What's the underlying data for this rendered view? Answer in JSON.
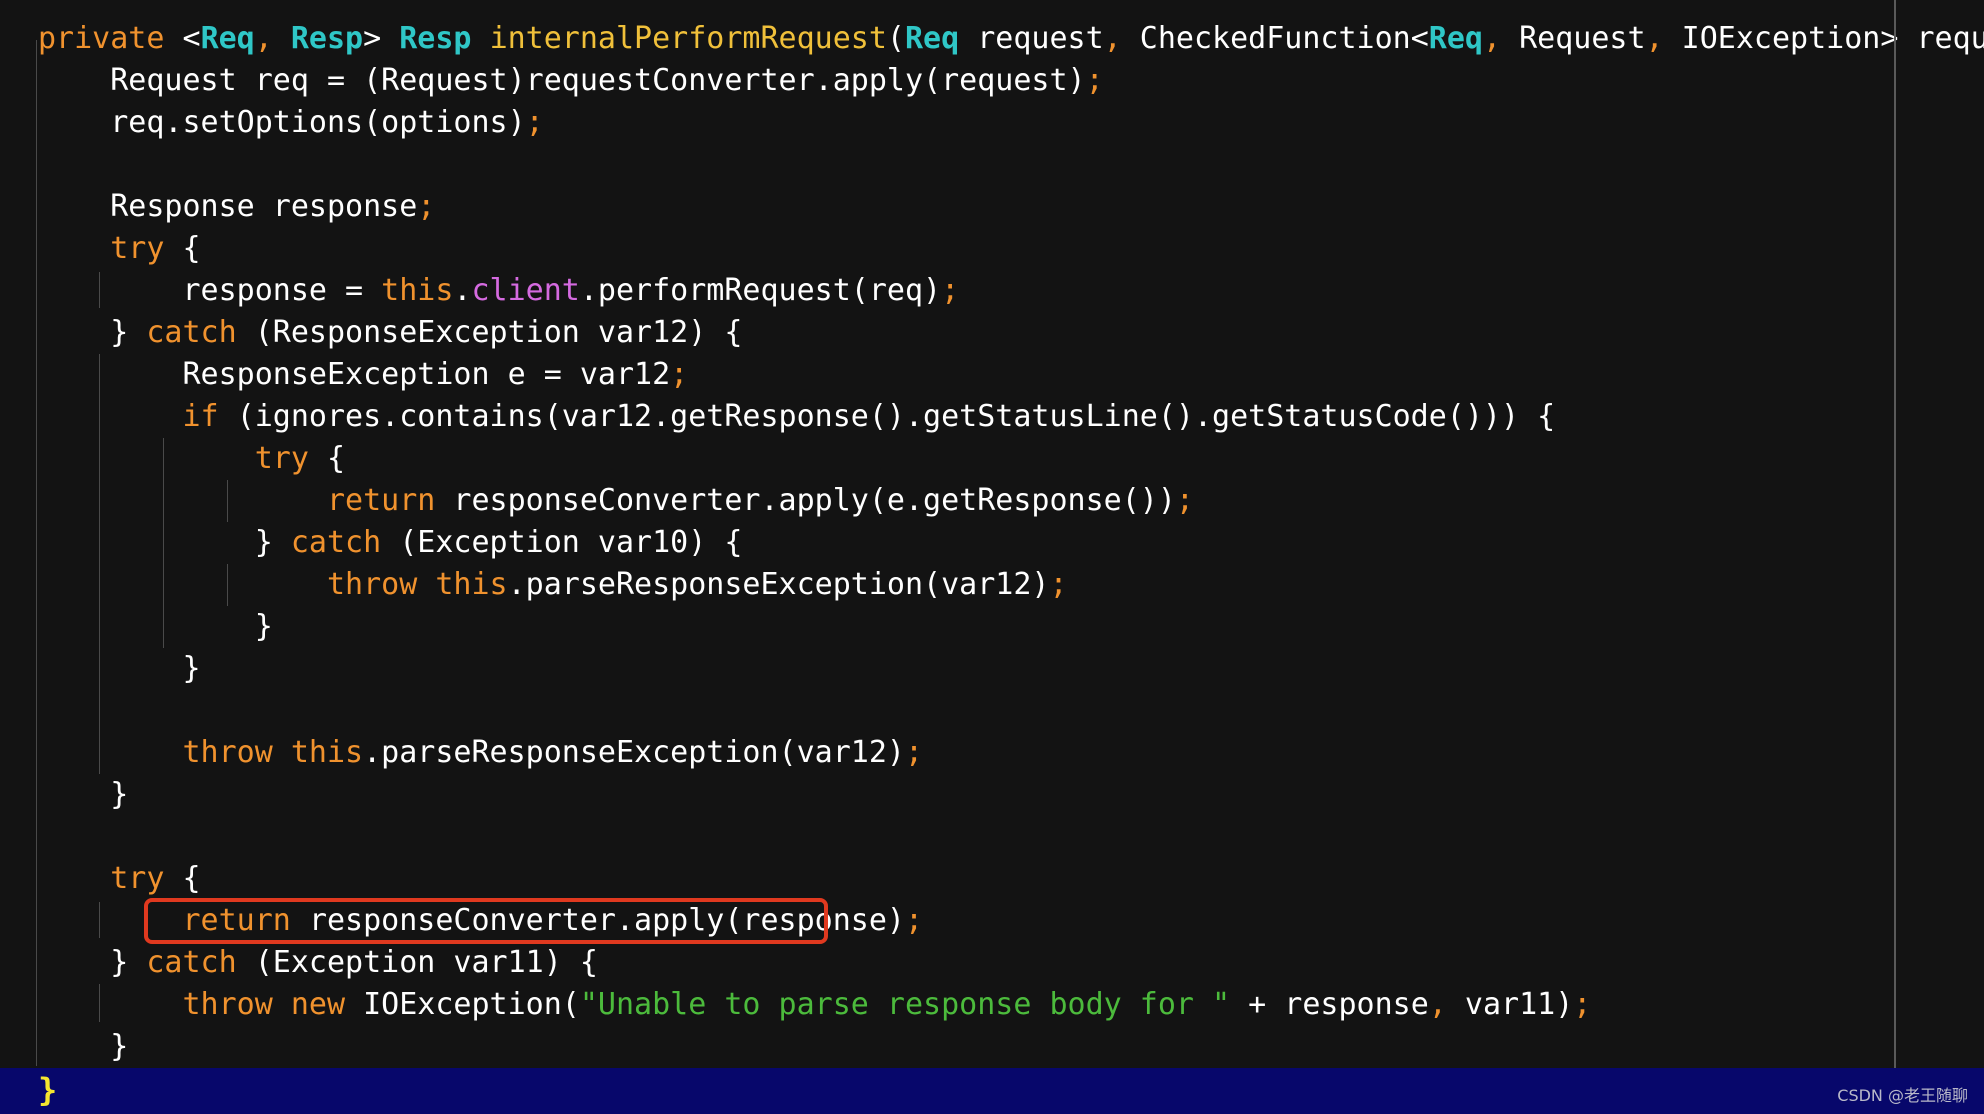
{
  "editor": {
    "lines": [
      [
        [
          "kw",
          "private "
        ],
        [
          "plain",
          "<"
        ],
        [
          "type",
          "Req"
        ],
        [
          "punct",
          ", "
        ],
        [
          "type",
          "Resp"
        ],
        [
          "plain",
          "> "
        ],
        [
          "type",
          "Resp"
        ],
        [
          "plain",
          " "
        ],
        [
          "fn",
          "internalPerformRequest"
        ],
        [
          "plain",
          "("
        ],
        [
          "type",
          "Req"
        ],
        [
          "plain",
          " request"
        ],
        [
          "punct",
          ", "
        ],
        [
          "plain",
          "CheckedFunction<"
        ],
        [
          "type",
          "Req"
        ],
        [
          "punct",
          ", "
        ],
        [
          "plain",
          "Request"
        ],
        [
          "punct",
          ", "
        ],
        [
          "plain",
          "IOException> requestConverter"
        ],
        [
          "punct",
          ","
        ]
      ],
      [
        [
          "plain",
          "    Request req = (Request)requestConverter.apply(request)"
        ],
        [
          "punct",
          ";"
        ]
      ],
      [
        [
          "plain",
          "    req.setOptions(options)"
        ],
        [
          "punct",
          ";"
        ]
      ],
      [],
      [
        [
          "plain",
          "    Response response"
        ],
        [
          "punct",
          ";"
        ]
      ],
      [
        [
          "kw",
          "    try "
        ],
        [
          "plain",
          "{"
        ]
      ],
      [
        [
          "plain",
          "        response = "
        ],
        [
          "kw",
          "this"
        ],
        [
          "plain",
          "."
        ],
        [
          "field",
          "client"
        ],
        [
          "plain",
          ".performRequest(req)"
        ],
        [
          "punct",
          ";"
        ]
      ],
      [
        [
          "plain",
          "    } "
        ],
        [
          "kw",
          "catch "
        ],
        [
          "plain",
          "(ResponseException var12) {"
        ]
      ],
      [
        [
          "plain",
          "        ResponseException e = var12"
        ],
        [
          "punct",
          ";"
        ]
      ],
      [
        [
          "kw",
          "        if "
        ],
        [
          "plain",
          "(ignores.contains(var12.getResponse().getStatusLine().getStatusCode())) {"
        ]
      ],
      [
        [
          "kw",
          "            try "
        ],
        [
          "plain",
          "{"
        ]
      ],
      [
        [
          "kw",
          "                return "
        ],
        [
          "plain",
          "responseConverter.apply(e.getResponse())"
        ],
        [
          "punct",
          ";"
        ]
      ],
      [
        [
          "plain",
          "            } "
        ],
        [
          "kw",
          "catch "
        ],
        [
          "plain",
          "(Exception var10) {"
        ]
      ],
      [
        [
          "kw",
          "                throw this"
        ],
        [
          "plain",
          ".parseResponseException(var12)"
        ],
        [
          "punct",
          ";"
        ]
      ],
      [
        [
          "plain",
          "            }"
        ]
      ],
      [
        [
          "plain",
          "        }"
        ]
      ],
      [],
      [
        [
          "kw",
          "        throw this"
        ],
        [
          "plain",
          ".parseResponseException(var12)"
        ],
        [
          "punct",
          ";"
        ]
      ],
      [
        [
          "plain",
          "    }"
        ]
      ],
      [],
      [
        [
          "kw",
          "    try "
        ],
        [
          "plain",
          "{"
        ]
      ],
      [
        [
          "kw",
          "        return "
        ],
        [
          "plain",
          "responseConverter.apply(response)"
        ],
        [
          "punct",
          ";"
        ]
      ],
      [
        [
          "plain",
          "    } "
        ],
        [
          "kw",
          "catch "
        ],
        [
          "plain",
          "(Exception var11) {"
        ]
      ],
      [
        [
          "kw",
          "        throw new "
        ],
        [
          "plain",
          "IOException("
        ],
        [
          "str",
          "\"Unable to parse response body for \""
        ],
        [
          "plain",
          " + response"
        ],
        [
          "punct",
          ", "
        ],
        [
          "plain",
          "var11)"
        ],
        [
          "punct",
          ";"
        ]
      ],
      [
        [
          "plain",
          "    }"
        ]
      ]
    ],
    "closing_brace": "}",
    "watermark": "CSDN @老王随聊"
  },
  "colors": {
    "background": "#131313",
    "keyword": "#f0922e",
    "type": "#2fc7c7",
    "function": "#f0c03a",
    "field": "#d56ae0",
    "string": "#4cbb3c",
    "highlight_box": "#e0391f",
    "status_bar": "#07076b",
    "closing_brace": "#f5e52f"
  }
}
